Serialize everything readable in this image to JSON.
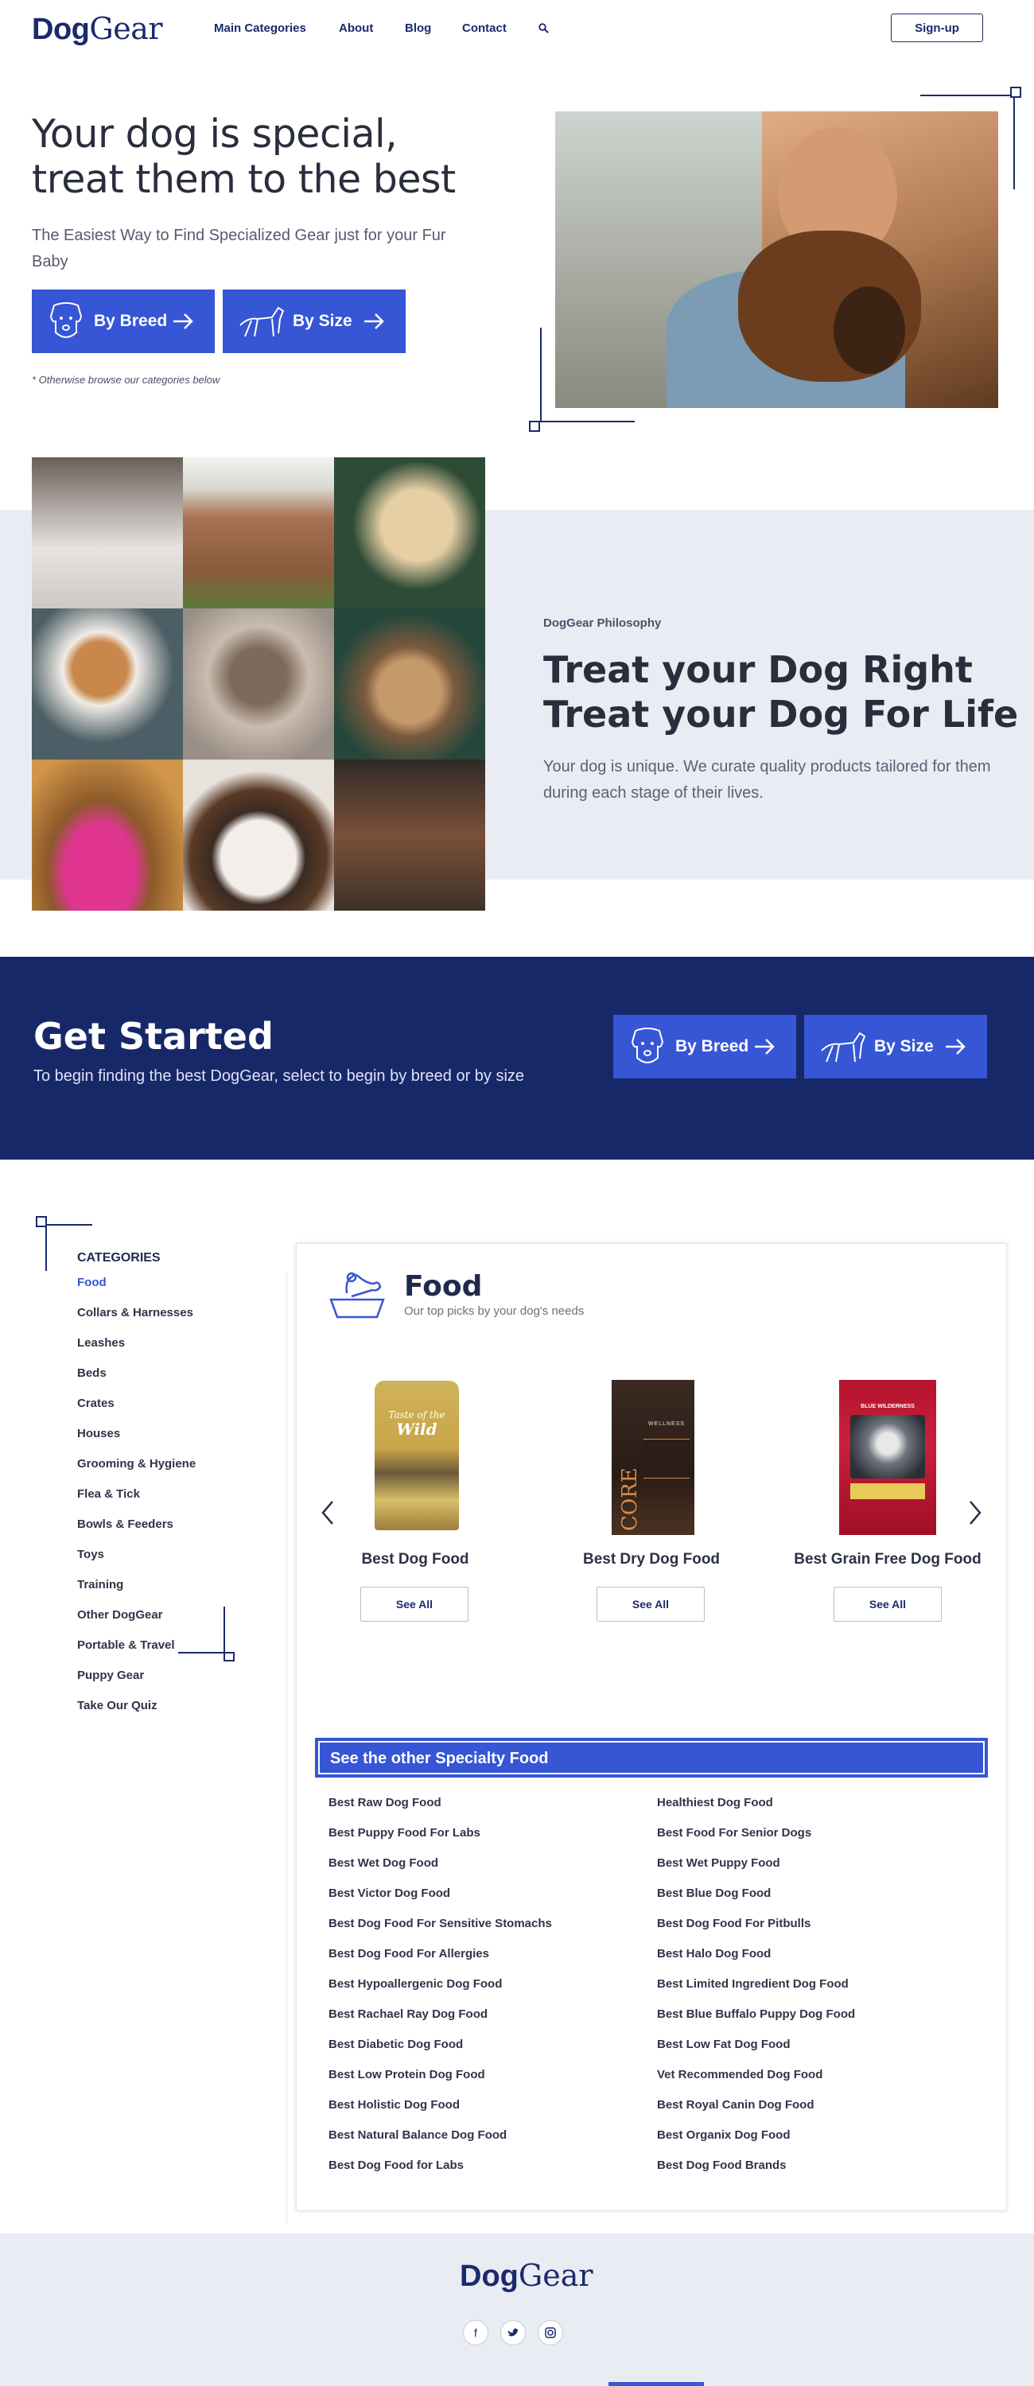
{
  "header": {
    "logo_bold": "Dog",
    "logo_light": "Gear",
    "nav": [
      "Main Categories",
      "About",
      "Blog",
      "Contact"
    ],
    "signup_label": "Sign-up"
  },
  "hero": {
    "title": "Your dog is special, treat them to the best",
    "subtitle": "The Easiest Way to Find Specialized Gear just for your Fur Baby",
    "by_breed_label": "By Breed",
    "by_size_label": "By Size",
    "note": "* Otherwise browse our categories below"
  },
  "philosophy": {
    "eyebrow": "DogGear Philosophy",
    "title_line1": "Treat your Dog Right",
    "title_line2": "Treat your Dog For Life",
    "text": "Your dog is unique. We curate quality products tailored for them during each stage of their lives."
  },
  "get_started": {
    "title": "Get Started",
    "subtitle": "To begin finding the best DogGear, select to begin by breed or by size",
    "by_breed_label": "By Breed",
    "by_size_label": "By Size"
  },
  "categories": {
    "heading": "CATEGORIES",
    "items": [
      "Food",
      "Collars & Harnesses",
      "Leashes",
      "Beds",
      "Crates",
      "Houses",
      "Grooming & Hygiene",
      "Flea & Tick",
      "Bowls & Feeders",
      "Toys",
      "Training",
      "Other DogGear",
      "Portable & Travel",
      "Puppy Gear",
      "Take Our Quiz"
    ]
  },
  "food": {
    "title": "Food",
    "subtitle": "Our top picks by your dog's needs",
    "products": [
      {
        "name": "Best Dog Food",
        "button": "See All"
      },
      {
        "name": "Best Dry Dog Food",
        "button": "See All"
      },
      {
        "name": "Best Grain Free Dog Food",
        "button": "See All"
      }
    ],
    "bag1_text_line1": "Taste of the",
    "bag1_text_line2": "Wild",
    "bag2_text": "CORE",
    "bag2_brand": "WELLNESS",
    "bag3_brand": "BLUE WILDERNESS"
  },
  "specialty": {
    "heading": "See the other Specialty Food",
    "left": [
      "Best Raw Dog Food",
      "Best Puppy Food For Labs",
      "Best Wet Dog Food",
      "Best Victor Dog Food",
      "Best Dog Food For Sensitive Stomachs",
      "Best Dog Food For Allergies",
      "Best Hypoallergenic Dog Food",
      "Best Rachael Ray Dog Food",
      "Best Diabetic Dog Food",
      "Best Low Protein Dog Food",
      "Best Holistic Dog Food",
      "Best Natural Balance Dog Food",
      "Best Dog Food for Labs"
    ],
    "right": [
      "Healthiest Dog Food",
      "Best Food For Senior Dogs",
      "Best Wet Puppy Food",
      "Best Blue Dog Food",
      "Best Dog Food For Pitbulls",
      "Best Halo Dog Food",
      "Best Limited Ingredient Dog Food",
      "Best Blue Buffalo Puppy Dog Food",
      "Best Low Fat Dog Food",
      "Vet Recommended Dog Food",
      "Best Royal Canin Dog Food",
      "Best Organix Dog Food",
      "Best Dog Food Brands"
    ]
  },
  "footer": {
    "logo_bold": "Dog",
    "logo_light": "Gear",
    "social": [
      "f",
      "t",
      "ig"
    ]
  }
}
